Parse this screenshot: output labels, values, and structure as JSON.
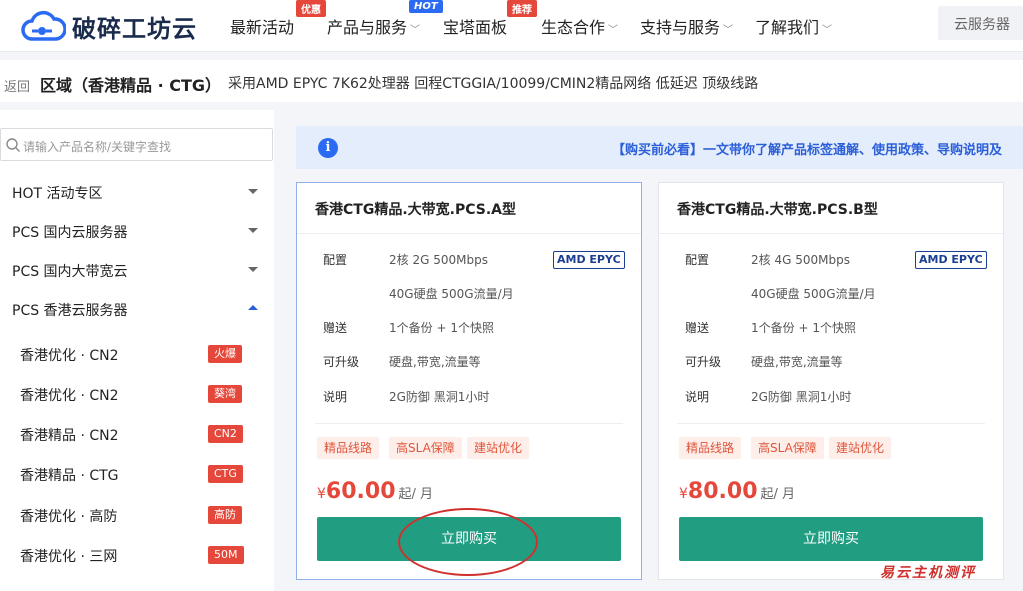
{
  "brand": {
    "name": "破碎工坊云"
  },
  "nav": {
    "items": [
      {
        "label": "最新活动",
        "badge": "优惠"
      },
      {
        "label": "产品与服务",
        "badge": "HOT"
      },
      {
        "label": "宝塔面板",
        "badge": "推荐"
      },
      {
        "label": "生态合作"
      },
      {
        "label": "支持与服务"
      },
      {
        "label": "了解我们"
      }
    ],
    "search_label": "云服务器"
  },
  "breadcrumb": {
    "back": "返回",
    "title": "区域（香港精品 · CTG）",
    "desc": "采用AMD EPYC 7K62处理器 回程CTGGIA/10099/CMIN2精品网络 低延迟 顶级线路"
  },
  "sidebar": {
    "search_placeholder": "请输入产品名称/关键字查找",
    "groups": [
      {
        "label": "HOT 活动专区"
      },
      {
        "label": "PCS 国内云服务器"
      },
      {
        "label": "PCS 国内大带宽云"
      },
      {
        "label": "PCS 香港云服务器"
      }
    ],
    "subitems": [
      {
        "label": "香港优化 · CN2",
        "tag": "火爆"
      },
      {
        "label": "香港优化 · CN2",
        "tag": "葵湾"
      },
      {
        "label": "香港精品 · CN2",
        "tag": "CN2"
      },
      {
        "label": "香港精品 · CTG",
        "tag": "CTG"
      },
      {
        "label": "香港优化 · 高防",
        "tag": "高防"
      },
      {
        "label": "香港优化 · 三网",
        "tag": "50M"
      }
    ]
  },
  "notice": {
    "text": "【购买前必看】一文带你了解产品标签通解、使用政策、导购说明及"
  },
  "labels": {
    "config": "配置",
    "gift": "赠送",
    "upgrade": "可升级",
    "note": "说明"
  },
  "cards": [
    {
      "title": "香港CTG精品.大带宽.PCS.A型",
      "cpu_badge": "AMD EPYC",
      "config_line1": "2核 2G 500Mbps",
      "config_line2": "40G硬盘 500G流量/月",
      "gift": "1个备份 + 1个快照",
      "upgrade": "硬盘,带宽,流量等",
      "note": "2G防御 黑洞1小时",
      "tags": [
        "精品线路",
        "高SLA保障",
        "建站优化"
      ],
      "currency": "¥",
      "price": "60.00",
      "unit": "起/ 月",
      "buy": "立即购买"
    },
    {
      "title": "香港CTG精品.大带宽.PCS.B型",
      "cpu_badge": "AMD EPYC",
      "config_line1": "2核 4G 500Mbps",
      "config_line2": "40G硬盘 500G流量/月",
      "gift": "1个备份 + 1个快照",
      "upgrade": "硬盘,带宽,流量等",
      "note": "2G防御 黑洞1小时",
      "tags": [
        "精品线路",
        "高SLA保障",
        "建站优化"
      ],
      "currency": "¥",
      "price": "80.00",
      "unit": "起/ 月",
      "buy": "立即购买"
    }
  ],
  "watermark": "易云主机测评",
  "colors": {
    "accent": "#2b6af3",
    "buy_button": "#219d82",
    "price": "#e5483b",
    "tag_red": "#e5483b"
  }
}
